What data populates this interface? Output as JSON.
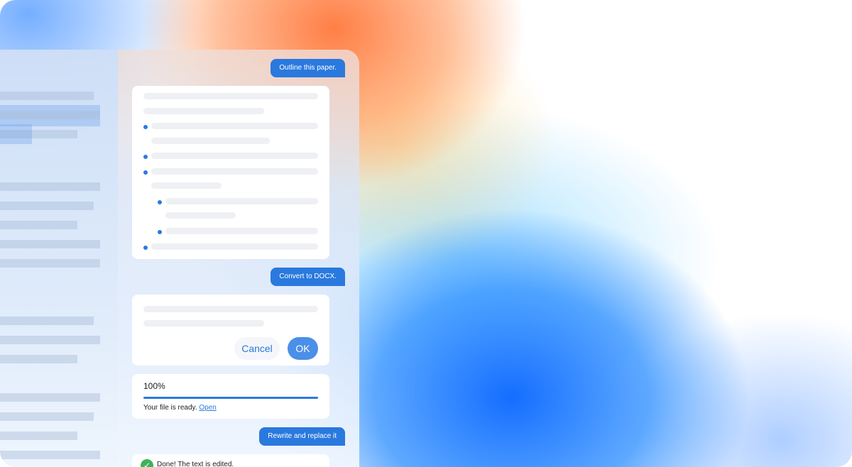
{
  "colors": {
    "accent": "#2a79de",
    "ok_button": "#4a8fe8",
    "success": "#3cb35a"
  },
  "chat": {
    "messages": [
      {
        "role": "user",
        "text": "Outline this paper."
      },
      {
        "role": "user",
        "text": "Convert to DOCX."
      },
      {
        "role": "user",
        "text": "Rewrite and replace it"
      }
    ],
    "dialog": {
      "cancel_label": "Cancel",
      "ok_label": "OK"
    },
    "progress": {
      "percent_text": "100%",
      "value": 1.0,
      "status_text": "Your file is ready.",
      "link_text": "Open"
    },
    "done": {
      "icon": "check-circle-icon",
      "text": "Done! The text is edited."
    }
  }
}
